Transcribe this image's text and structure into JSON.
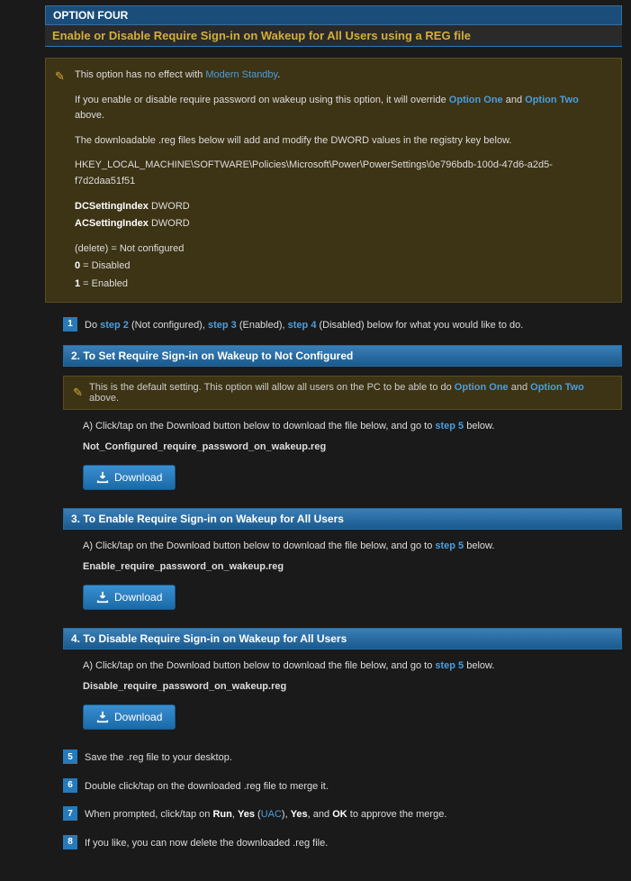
{
  "option_label": "OPTION FOUR",
  "title": "Enable or Disable Require Sign-in on Wakeup for All Users using a REG file",
  "note": {
    "line1_a": "This option has no effect with ",
    "line1_link": "Modern Standby",
    "line1_b": ".",
    "line2_a": "If you enable or disable require password on wakeup using this option, it will override ",
    "opt1": "Option One",
    "and": " and ",
    "opt2": "Option Two",
    "line2_b": " above.",
    "line3": "The downloadable .reg files below will add and modify the DWORD values in the registry key below.",
    "reg_path": "HKEY_LOCAL_MACHINE\\SOFTWARE\\Policies\\Microsoft\\Power\\PowerSettings\\0e796bdb-100d-47d6-a2d5-f7d2daa51f51",
    "dc_b": "DCSettingIndex",
    "dc_t": " DWORD",
    "ac_b": "ACSettingIndex",
    "ac_t": " DWORD",
    "del": "(delete) = Not configured",
    "zero_b": "0",
    "zero_t": " = Disabled",
    "one_b": "1",
    "one_t": " = Enabled"
  },
  "step1": {
    "num": "1",
    "a": "Do ",
    "s2": "step 2",
    "b": " (Not configured), ",
    "s3": "step 3",
    "c": " (Enabled), ",
    "s4": "step 4",
    "d": " (Disabled) below for what you would like to do."
  },
  "sec2": {
    "header": "2. To Set Require Sign-in on Wakeup to Not Configured",
    "note_a": "This is the default setting. This option will allow all users on the PC to be able to do ",
    "opt1": "Option One",
    "and": " and ",
    "opt2": "Option Two",
    "note_b": " above.",
    "instr_a": "A) Click/tap on the Download button below to download the file below, and go to ",
    "s5": "step 5",
    "instr_b": " below.",
    "file": "Not_Configured_require_password_on_wakeup.reg",
    "btn": "Download"
  },
  "sec3": {
    "header": "3. To Enable Require Sign-in on Wakeup for All Users",
    "instr_a": "A) Click/tap on the Download button below to download the file below, and go to ",
    "s5": "step 5",
    "instr_b": " below.",
    "file": "Enable_require_password_on_wakeup.reg",
    "btn": "Download"
  },
  "sec4": {
    "header": "4. To Disable Require Sign-in on Wakeup for All Users",
    "instr_a": "A) Click/tap on the Download button below to download the file below, and go to ",
    "s5": "step 5",
    "instr_b": " below.",
    "file": "Disable_require_password_on_wakeup.reg",
    "btn": "Download"
  },
  "step5": {
    "num": "5",
    "text": "Save the .reg file to your desktop."
  },
  "step6": {
    "num": "6",
    "text": "Double click/tap on the downloaded .reg file to merge it."
  },
  "step7": {
    "num": "7",
    "a": "When prompted, click/tap on ",
    "run": "Run",
    "c1": ", ",
    "yes1": "Yes",
    "paren_a": " (",
    "uac": "UAC",
    "paren_b": "), ",
    "yes2": "Yes",
    "c2": ", and ",
    "ok": "OK",
    "b": " to approve the merge."
  },
  "step8": {
    "num": "8",
    "text": "If you like, you can now delete the downloaded .reg file."
  }
}
